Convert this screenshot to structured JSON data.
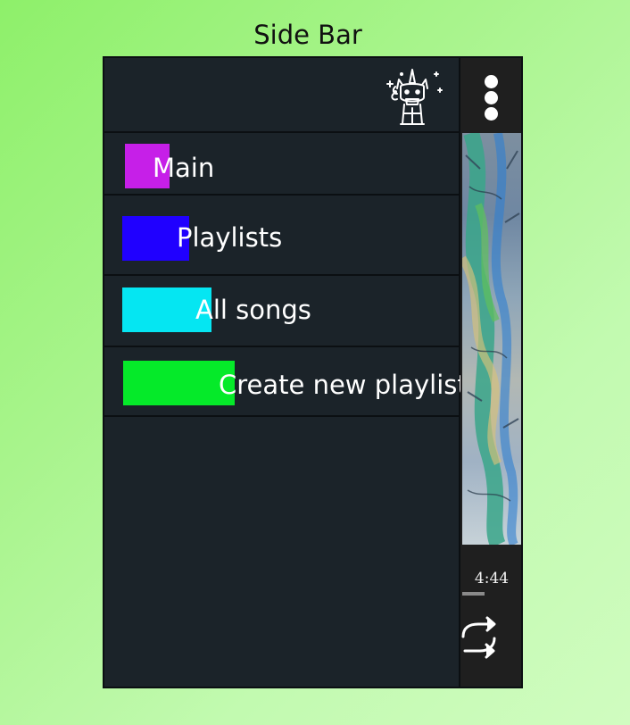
{
  "page": {
    "title": "Side Bar"
  },
  "sidebar": {
    "logo": {
      "icon": "unicorn-icon"
    },
    "items": [
      {
        "label": "Main",
        "color": "#c61fe8"
      },
      {
        "label": "Playlists",
        "color": "#2000ff"
      },
      {
        "label": "All songs",
        "color": "#05e6f2"
      },
      {
        "label": "Create new playlist",
        "color": "#05ea29"
      }
    ]
  },
  "player": {
    "menu_icon": "more-vertical-icon",
    "time": "4:44",
    "progress": 0.35,
    "repeat_icon": "repeat-icon"
  }
}
